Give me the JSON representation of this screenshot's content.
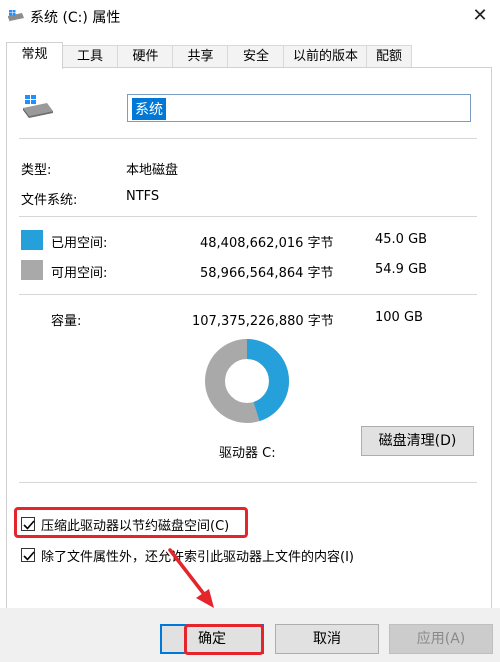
{
  "window": {
    "title": "系统 (C:) 属性",
    "close_glyph": "✕"
  },
  "tabs": [
    {
      "label": "常规",
      "active": true
    },
    {
      "label": "工具"
    },
    {
      "label": "硬件"
    },
    {
      "label": "共享"
    },
    {
      "label": "安全"
    },
    {
      "label": "以前的版本"
    },
    {
      "label": "配额"
    }
  ],
  "drive": {
    "name_value": "系统",
    "type_label": "类型:",
    "type_value": "本地磁盘",
    "fs_label": "文件系统:",
    "fs_value": "NTFS"
  },
  "usage": {
    "used_label": "已用空间:",
    "used_bytes": "48,408,662,016 字节",
    "used_size": "45.0 GB",
    "used_fraction": 0.4508,
    "free_label": "可用空间:",
    "free_bytes": "58,966,564,864 字节",
    "free_size": "54.9 GB",
    "capacity_label": "容量:",
    "capacity_bytes": "107,375,226,880 字节",
    "capacity_size": "100 GB",
    "used_color": "#26a0da",
    "free_color": "#a9a9a9",
    "drive_label": "驱动器 C:",
    "cleanup_button": "磁盘清理(D)"
  },
  "options": {
    "compress_label": "压缩此驱动器以节约磁盘空间(C)",
    "compress_checked": true,
    "index_label": "除了文件属性外，还允许索引此驱动器上文件的内容(I)",
    "index_checked": true
  },
  "buttons": {
    "ok": "确定",
    "cancel": "取消",
    "apply": "应用(A)"
  },
  "annotation_color": "#e4252b"
}
